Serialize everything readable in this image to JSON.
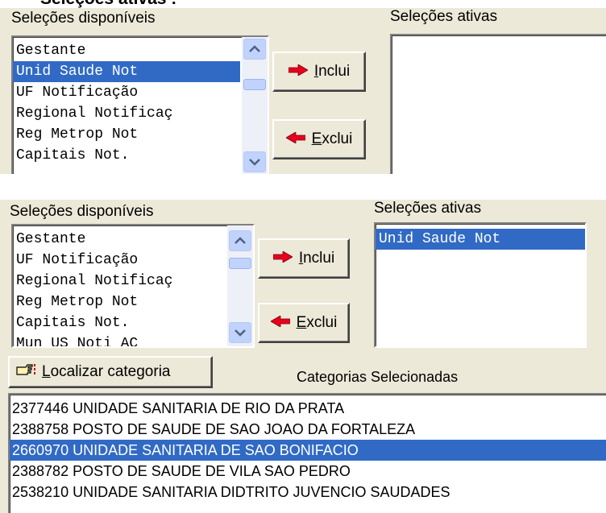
{
  "header_title": "Seleções ativas :",
  "top": {
    "available_label": "Seleções disponíveis",
    "active_label": "Seleções ativas",
    "available_items": [
      {
        "label": "Gestante",
        "selected": false
      },
      {
        "label": "Unid Saude Not",
        "selected": true
      },
      {
        "label": "UF Notificação",
        "selected": false
      },
      {
        "label": "Regional Notificaç",
        "selected": false
      },
      {
        "label": "Reg Metrop Not",
        "selected": false
      },
      {
        "label": "Capitais Not.",
        "selected": false
      }
    ],
    "active_items": [],
    "include_button": {
      "underlined": "I",
      "rest": "nclui"
    },
    "exclude_button": {
      "underlined": "E",
      "rest": "xclui"
    }
  },
  "bottom": {
    "available_label": "Seleções disponíveis",
    "active_label": "Seleções ativas",
    "available_items": [
      {
        "label": "Gestante",
        "selected": false
      },
      {
        "label": "UF Notificação",
        "selected": false
      },
      {
        "label": "Regional Notificaç",
        "selected": false
      },
      {
        "label": "Reg Metrop Not",
        "selected": false
      },
      {
        "label": "Capitais Not.",
        "selected": false
      },
      {
        "label": "Mun US Noti AC",
        "selected": false
      }
    ],
    "active_items": [
      {
        "label": "Unid Saude Not",
        "selected": true
      }
    ],
    "include_button": {
      "underlined": "I",
      "rest": "nclui"
    },
    "exclude_button": {
      "underlined": "E",
      "rest": "xclui"
    },
    "locate_button": {
      "underlined": "L",
      "rest": "ocalizar categoria"
    },
    "categories_label": "Categorias Selecionadas",
    "categories": [
      {
        "label": "2377446 UNIDADE SANITARIA DE RIO DA PRATA",
        "selected": false
      },
      {
        "label": "2388758 POSTO DE SAUDE DE SAO JOAO DA FORTALEZA",
        "selected": false
      },
      {
        "label": "2660970 UNIDADE SANITARIA DE SAO BONIFACIO",
        "selected": true
      },
      {
        "label": "2388782 POSTO DE SAUDE DE VILA SAO PEDRO",
        "selected": false
      },
      {
        "label": "2538210 UNIDADE SANITARIA DIDTRITO JUVENCIO SAUDADES",
        "selected": false
      }
    ]
  },
  "colors": {
    "panel": "#ece9d8",
    "selection": "#316ac5",
    "arrow": "#e8001c"
  }
}
